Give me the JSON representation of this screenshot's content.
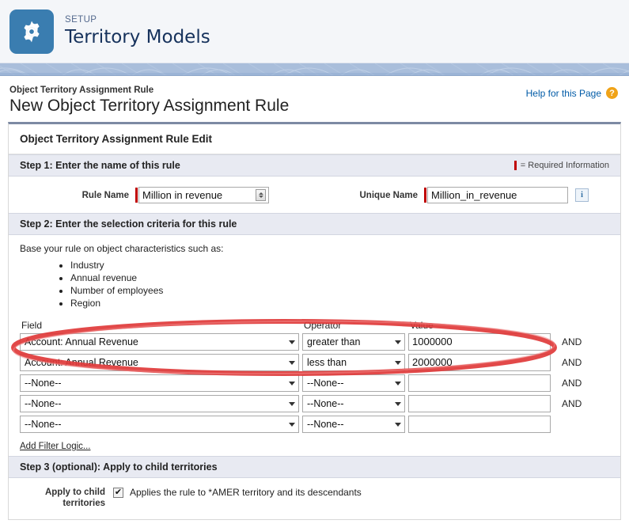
{
  "setup_header": {
    "eyebrow": "SETUP",
    "title": "Territory Models",
    "icon": "gear-icon",
    "icon_bg": "#3a7db0"
  },
  "page": {
    "breadcrumb": "Object Territory Assignment Rule",
    "title": "New Object Territory Assignment Rule",
    "help_link": "Help for this Page",
    "help_icon": "?"
  },
  "card": {
    "title": "Object Territory Assignment Rule Edit"
  },
  "step1": {
    "header": "Step 1: Enter the name of this rule",
    "required_legend": "= Required Information",
    "rule_name_label": "Rule Name",
    "rule_name_value": "Million in revenue",
    "unique_name_label": "Unique Name",
    "unique_name_value": "Million_in_revenue",
    "info_icon": "i"
  },
  "step2": {
    "header": "Step 2: Enter the selection criteria for this rule",
    "lead": "Base your rule on object characteristics such as:",
    "characteristics": [
      "Industry",
      "Annual revenue",
      "Number of employees",
      "Region"
    ],
    "columns": {
      "field": "Field",
      "operator": "Operator",
      "value": "Value"
    },
    "rows": [
      {
        "field": "Account: Annual Revenue",
        "operator": "greater than",
        "value": "1000000",
        "conj": "AND"
      },
      {
        "field": "Account: Annual Revenue",
        "operator": "less than",
        "value": "2000000",
        "conj": "AND"
      },
      {
        "field": "--None--",
        "operator": "--None--",
        "value": "",
        "conj": "AND"
      },
      {
        "field": "--None--",
        "operator": "--None--",
        "value": "",
        "conj": "AND"
      },
      {
        "field": "--None--",
        "operator": "--None--",
        "value": "",
        "conj": ""
      }
    ],
    "add_filter_logic": "Add Filter Logic...",
    "annotation_color": "#e03a3a"
  },
  "step3": {
    "header": "Step 3 (optional): Apply to child territories",
    "label": "Apply to child territories",
    "checkbox_checked": true,
    "checkbox_mark": "✔",
    "text": "Applies the rule to *AMER territory and its descendants"
  }
}
